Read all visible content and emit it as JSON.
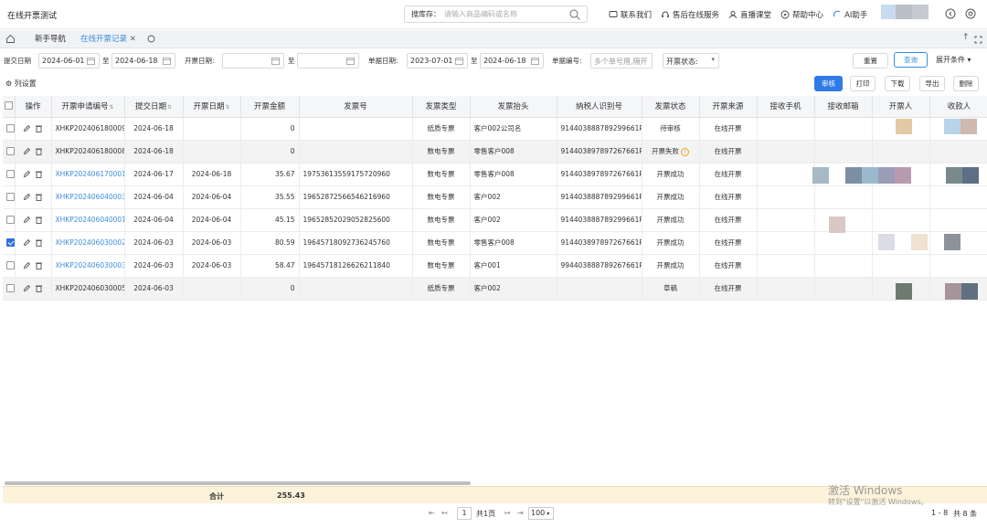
{
  "app": {
    "title": "在线开票测试"
  },
  "search": {
    "label": "搜库存：",
    "placeholder": "请输入商品编码或名称"
  },
  "topnav": [
    "联系我们",
    "售后在线服务",
    "直播课堂",
    "帮助中心",
    "AI助手"
  ],
  "tabs": [
    {
      "label": "新手导航",
      "active": false
    },
    {
      "label": "在线开票记录",
      "active": true
    }
  ],
  "filters": {
    "submit_date_label": "提交日期",
    "submit_date_from": "2024-06-01",
    "submit_date_to": "2024-06-18",
    "range_sep": "至",
    "invoice_date_label": "开票日期:",
    "invoice_date_from": "",
    "invoice_date_to": "",
    "doc_date_label": "单据日期:",
    "doc_date_from": "2023-07-01",
    "doc_date_to": "2024-06-18",
    "doc_no_label": "单据编号:",
    "doc_no_placeholder": "多个单号用,隔开",
    "status_label": "开票状态:",
    "reset": "重置",
    "query": "查询",
    "expand": "展开条件"
  },
  "toolbar": {
    "col_settings": "列设置",
    "buttons": [
      "审核",
      "打印",
      "下载",
      "导出",
      "删除"
    ]
  },
  "columns": [
    "操作",
    "开票申请编号",
    "提交日期",
    "开票日期",
    "开票金额",
    "发票号",
    "发票类型",
    "发票抬头",
    "纳税人识别号",
    "发票状态",
    "开票来源",
    "接收手机",
    "接收邮箱",
    "开票人",
    "收款人"
  ],
  "rows": [
    {
      "checked": false,
      "gray": false,
      "link": false,
      "no": "XHKP202406180009",
      "submit": "2024-06-18",
      "invdate": "",
      "amount": "0",
      "invno": "",
      "type": "纸质专票",
      "title": "客户002公司名",
      "taxid": "914403888789299661P",
      "status": "待审核",
      "warn": false,
      "source": "在线开票"
    },
    {
      "checked": false,
      "gray": true,
      "link": false,
      "no": "XHKP202406180008",
      "submit": "2024-06-18",
      "invdate": "",
      "amount": "0",
      "invno": "",
      "type": "数电专票",
      "title": "零售客户008",
      "taxid": "914403897897267661P",
      "status": "开票失败",
      "warn": true,
      "source": "在线开票"
    },
    {
      "checked": false,
      "gray": false,
      "link": true,
      "no": "XHKP202406170001",
      "submit": "2024-06-17",
      "invdate": "2024-06-18",
      "amount": "35.67",
      "invno": "19753613559175720960",
      "type": "数电专票",
      "title": "零售客户008",
      "taxid": "914403897897267661P",
      "status": "开票成功",
      "warn": false,
      "source": "在线开票"
    },
    {
      "checked": false,
      "gray": false,
      "link": true,
      "no": "XHKP202406040003",
      "submit": "2024-06-04",
      "invdate": "2024-06-04",
      "amount": "35.55",
      "invno": "19652872566546216960",
      "type": "数电专票",
      "title": "客户002",
      "taxid": "914403888789299661P",
      "status": "开票成功",
      "warn": false,
      "source": "在线开票"
    },
    {
      "checked": false,
      "gray": false,
      "link": true,
      "no": "XHKP202406040001",
      "submit": "2024-06-04",
      "invdate": "2024-06-04",
      "amount": "45.15",
      "invno": "19652852029052825600",
      "type": "数电专票",
      "title": "客户002",
      "taxid": "914403888789299661P",
      "status": "开票成功",
      "warn": false,
      "source": "在线开票"
    },
    {
      "checked": true,
      "gray": false,
      "link": true,
      "no": "XHKP202406030002",
      "submit": "2024-06-03",
      "invdate": "2024-06-03",
      "amount": "80.59",
      "invno": "19645718092736245760",
      "type": "数电专票",
      "title": "零售客户008",
      "taxid": "914403897897267661P",
      "status": "开票成功",
      "warn": false,
      "source": "在线开票"
    },
    {
      "checked": false,
      "gray": false,
      "link": true,
      "no": "XHKP202406030003",
      "submit": "2024-06-03",
      "invdate": "2024-06-03",
      "amount": "58.47",
      "invno": "19645718126626211840",
      "type": "数电专票",
      "title": "客户001",
      "taxid": "994403888789267661P",
      "status": "开票成功",
      "warn": false,
      "source": "在线开票"
    },
    {
      "checked": false,
      "gray": true,
      "link": false,
      "no": "XHKP202406030005",
      "submit": "2024-06-03",
      "invdate": "",
      "amount": "0",
      "invno": "",
      "type": "纸质专票",
      "title": "客户002",
      "taxid": "",
      "status": "草稿",
      "warn": false,
      "source": "在线开票"
    }
  ],
  "totals": {
    "label": "合计",
    "amount": "255.43"
  },
  "pager": {
    "page": "1",
    "total_pages": "共1页",
    "page_size": "100",
    "range": "1 - 8",
    "total": "共 8 条"
  },
  "watermark": {
    "line1": "激活 Windows",
    "line2": "转到\"设置\"以激活 Windows。"
  }
}
